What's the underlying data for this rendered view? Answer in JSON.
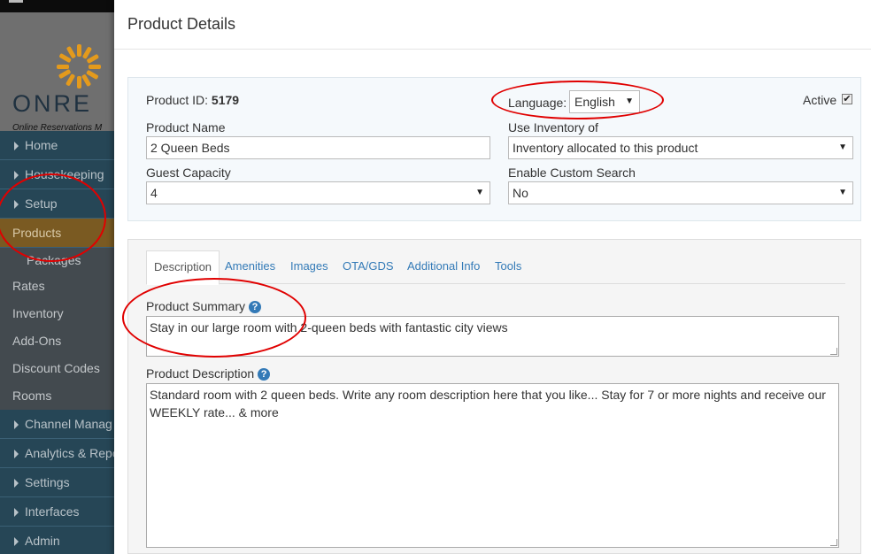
{
  "sidebar": {
    "brand": "ONRE",
    "tagline": "Online Reservations M",
    "items": [
      {
        "label": "Home",
        "caret": true
      },
      {
        "label": "Housekeeping",
        "caret": true
      },
      {
        "label": "Setup",
        "caret": true
      }
    ],
    "active_item": "Products",
    "sub_items": [
      {
        "label": "Packages",
        "indent": true
      },
      {
        "label": "Rates"
      },
      {
        "label": "Inventory"
      },
      {
        "label": "Add-Ons"
      },
      {
        "label": "Discount Codes"
      },
      {
        "label": "Rooms"
      }
    ],
    "bottom_items": [
      {
        "label": "Channel Manag"
      },
      {
        "label": "Analytics & Repo"
      },
      {
        "label": "Settings"
      },
      {
        "label": "Interfaces"
      },
      {
        "label": "Admin"
      }
    ]
  },
  "modal": {
    "title": "Product Details",
    "product_id_label": "Product ID:",
    "product_id": "5179",
    "language_label": "Language:",
    "language_value": "English",
    "active_label": "Active",
    "active_checked": true,
    "product_name_label": "Product Name",
    "product_name": "2 Queen Beds",
    "use_inventory_label": "Use Inventory of",
    "use_inventory_value": "Inventory allocated to this product",
    "guest_capacity_label": "Guest Capacity",
    "guest_capacity_value": "4",
    "custom_search_label": "Enable Custom Search",
    "custom_search_value": "No",
    "tabs": [
      "Description",
      "Amenities",
      "Images",
      "OTA/GDS",
      "Additional Info",
      "Tools"
    ],
    "summary_label": "Product Summary",
    "summary_value": "Stay in our large room with 2-queen beds with fantastic city views",
    "description_label": "Product Description",
    "description_value": "Standard room with 2 queen beds. Write any room description here that you like... Stay for 7 or more nights and receive our WEEKLY rate... & more"
  },
  "colors": {
    "sidebar_bg": "#264656",
    "active_bg": "#7a5a22",
    "link_blue": "#337ab7",
    "annotation_red": "#e00000"
  },
  "icons": [
    "hamburger-icon",
    "sun-logo-icon",
    "caret-right-icon",
    "help-circle-icon",
    "dropdown-arrow-icon",
    "checkbox-icon",
    "resize-grip-icon"
  ]
}
